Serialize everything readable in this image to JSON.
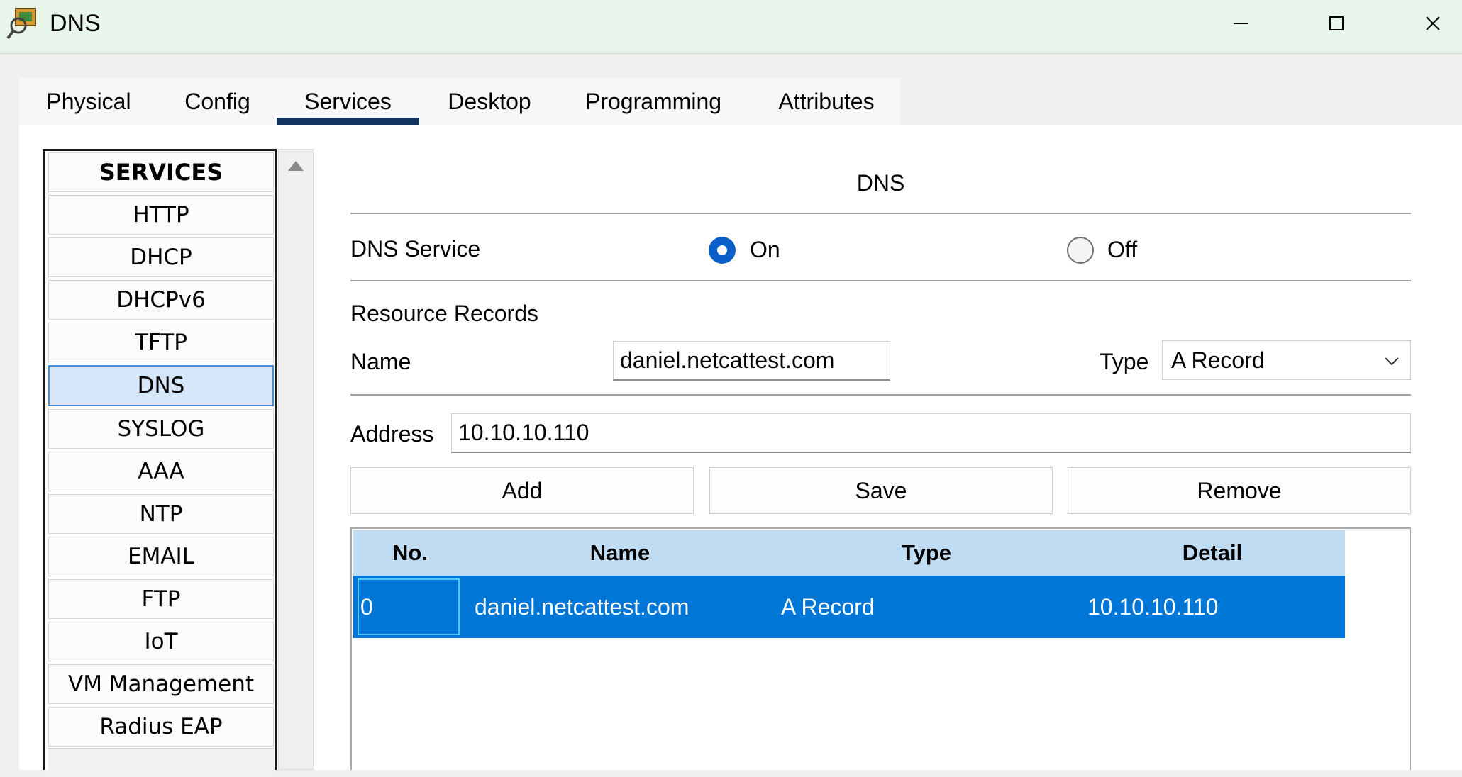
{
  "window": {
    "title": "DNS",
    "icon": "packet-tracer-server-icon",
    "controls": [
      "minimize-icon",
      "maximize-icon",
      "close-icon"
    ]
  },
  "tabs": [
    {
      "label": "Physical",
      "active": false
    },
    {
      "label": "Config",
      "active": false
    },
    {
      "label": "Services",
      "active": true
    },
    {
      "label": "Desktop",
      "active": false
    },
    {
      "label": "Programming",
      "active": false
    },
    {
      "label": "Attributes",
      "active": false
    }
  ],
  "sidebar": {
    "header": "SERVICES",
    "items": [
      "HTTP",
      "DHCP",
      "DHCPv6",
      "TFTP",
      "DNS",
      "SYSLOG",
      "AAA",
      "NTP",
      "EMAIL",
      "FTP",
      "IoT",
      "VM Management",
      "Radius EAP"
    ],
    "selected": "DNS"
  },
  "panel": {
    "title": "DNS",
    "service_label": "DNS Service",
    "on_label": "On",
    "off_label": "Off",
    "service_state": "On",
    "records_label": "Resource Records",
    "name_label": "Name",
    "name_value": "daniel.netcattest.com",
    "type_label": "Type",
    "type_value": "A Record",
    "address_label": "Address",
    "address_value": "10.10.10.110",
    "buttons": {
      "add": "Add",
      "save": "Save",
      "remove": "Remove"
    }
  },
  "table": {
    "headers": {
      "no": "No.",
      "name": "Name",
      "type": "Type",
      "detail": "Detail"
    },
    "rows": [
      {
        "no": "0",
        "name": "daniel.netcattest.com",
        "type": "A Record",
        "detail": "10.10.10.110",
        "selected": true
      }
    ]
  },
  "colors": {
    "accent": "#0a5ec8",
    "selected_row": "#0077d7",
    "table_header": "#bfdcf3",
    "active_tab_underline": "#13345e",
    "titlebar": "#e8f5ea"
  }
}
